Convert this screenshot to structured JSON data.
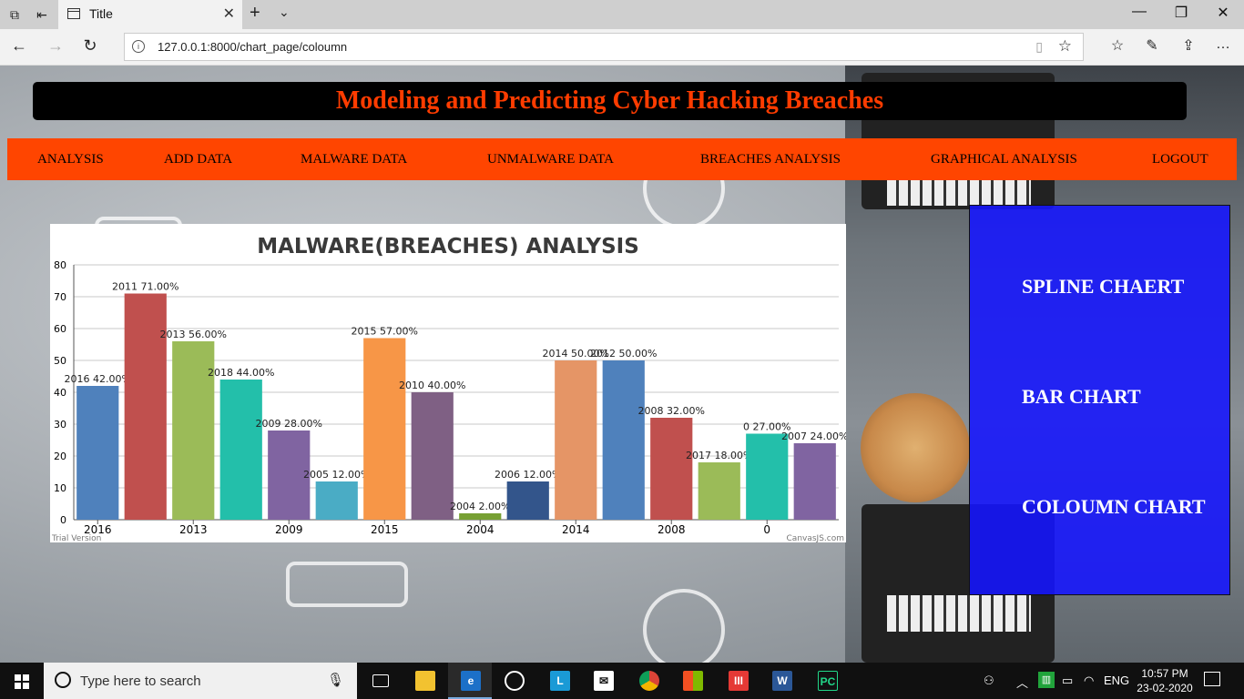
{
  "browser": {
    "tab_title": "Title",
    "url": "127.0.0.1:8000/chart_page/coloumn"
  },
  "page": {
    "title": "Modeling and Predicting Cyber Hacking Breaches",
    "menu": [
      "ANALYSIS",
      "ADD DATA",
      "MALWARE DATA",
      "UNMALWARE DATA",
      "BREACHES ANALYSIS",
      "GRAPHICAL ANALYSIS",
      "LOGOUT"
    ],
    "side_links": [
      "SPLINE CHAERT",
      "BAR CHART",
      "COLOUMN CHART"
    ],
    "accent_color": "#ff4500",
    "title_color": "#ff3c00",
    "side_panel_color": "#1414ff"
  },
  "chart_data": {
    "type": "bar",
    "title": "MALWARE(BREACHES) ANALYSIS",
    "categories": [
      "2016",
      "2011",
      "2013",
      "2018",
      "2009",
      "2005",
      "2015",
      "2010",
      "2004",
      "2006",
      "2014",
      "2012",
      "2008",
      "2017",
      "0",
      "2007"
    ],
    "values": [
      42,
      71,
      56,
      44,
      28,
      12,
      57,
      40,
      2,
      12,
      50,
      50,
      32,
      18,
      27,
      24
    ],
    "data_labels": [
      "2016 42.00%",
      "2011 71.00%",
      "2013 56.00%",
      "2018 44.00%",
      "2009 28.00%",
      "2005 12.00%",
      "2015 57.00%",
      "2010 40.00%",
      "2004 2.00%",
      "2006 12.00%",
      "2014 50.00%",
      "2012 50.00%",
      "2008 32.00%",
      "2017 18.00%",
      "0 27.00%",
      "2007 24.00%"
    ],
    "x_tick_labels": [
      "2016",
      "2013",
      "2009",
      "2015",
      "2004",
      "2014",
      "2008",
      "0"
    ],
    "y_ticks": [
      0,
      10,
      20,
      30,
      40,
      50,
      60,
      70,
      80
    ],
    "ylim": [
      0,
      80
    ],
    "colors": [
      "#4f81bc",
      "#c0504e",
      "#9bbb58",
      "#23bfaa",
      "#8064a1",
      "#4aacc5",
      "#f79647",
      "#7f6084",
      "#77a033",
      "#33558b",
      "#e59566",
      "#4f81bc",
      "#c0504e",
      "#9bbb58",
      "#23bfaa",
      "#8064a1"
    ],
    "grid": true,
    "footer_left": "Trial Version",
    "footer_right": "CanvasJS.com"
  },
  "taskbar": {
    "search_placeholder": "Type here to search",
    "language": "ENG",
    "time": "10:57 PM",
    "date": "23-02-2020"
  }
}
